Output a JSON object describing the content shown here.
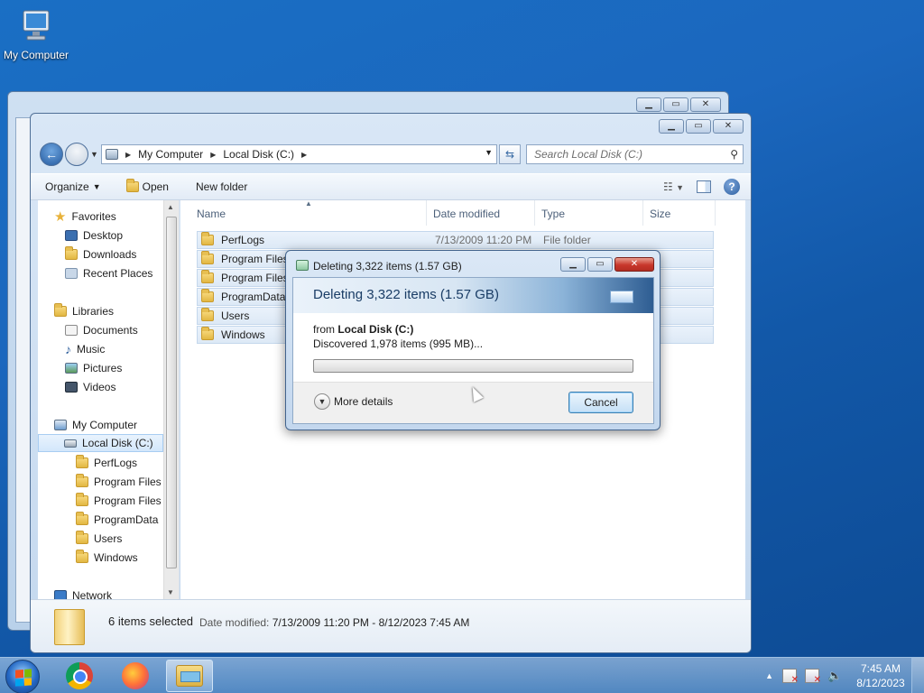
{
  "desktop": {
    "icon_label": "My Computer"
  },
  "window": {
    "address": {
      "crumbs": [
        "My Computer",
        "Local Disk (C:)"
      ]
    },
    "search_placeholder": "Search Local Disk (C:)",
    "toolbar": {
      "organize": "Organize",
      "open": "Open",
      "new_folder": "New folder"
    },
    "nav": {
      "favorites": "Favorites",
      "desktop": "Desktop",
      "downloads": "Downloads",
      "recent": "Recent Places",
      "libraries": "Libraries",
      "documents": "Documents",
      "music": "Music",
      "pictures": "Pictures",
      "videos": "Videos",
      "computer": "My Computer",
      "local_disk": "Local Disk (C:)",
      "sub": [
        "PerfLogs",
        "Program Files",
        "Program Files (",
        "ProgramData",
        "Users",
        "Windows"
      ],
      "network": "Network"
    },
    "columns": {
      "name": "Name",
      "date": "Date modified",
      "type": "Type",
      "size": "Size"
    },
    "files": [
      {
        "name": "PerfLogs",
        "date": "7/13/2009 11:20 PM",
        "type": "File folder"
      },
      {
        "name": "Program Files",
        "date": "",
        "type": ""
      },
      {
        "name": "Program Files (",
        "date": "",
        "type": ""
      },
      {
        "name": "ProgramData",
        "date": "",
        "type": ""
      },
      {
        "name": "Users",
        "date": "",
        "type": ""
      },
      {
        "name": "Windows",
        "date": "",
        "type": ""
      }
    ],
    "status": {
      "count": "6 items selected",
      "date_label": "Date modified:",
      "date_value": "7/13/2009 11:20 PM - 8/12/2023 7:45 AM"
    }
  },
  "dialog": {
    "title": "Deleting 3,322 items (1.57 GB)",
    "heading": "Deleting 3,322 items (1.57 GB)",
    "from_prefix": "from",
    "from_location": "Local Disk (C:)",
    "discovered": "Discovered 1,978 items (995 MB)...",
    "progress": 0,
    "more_details": "More details",
    "cancel": "Cancel"
  },
  "taskbar": {
    "time": "7:45 AM",
    "date": "8/12/2023"
  }
}
